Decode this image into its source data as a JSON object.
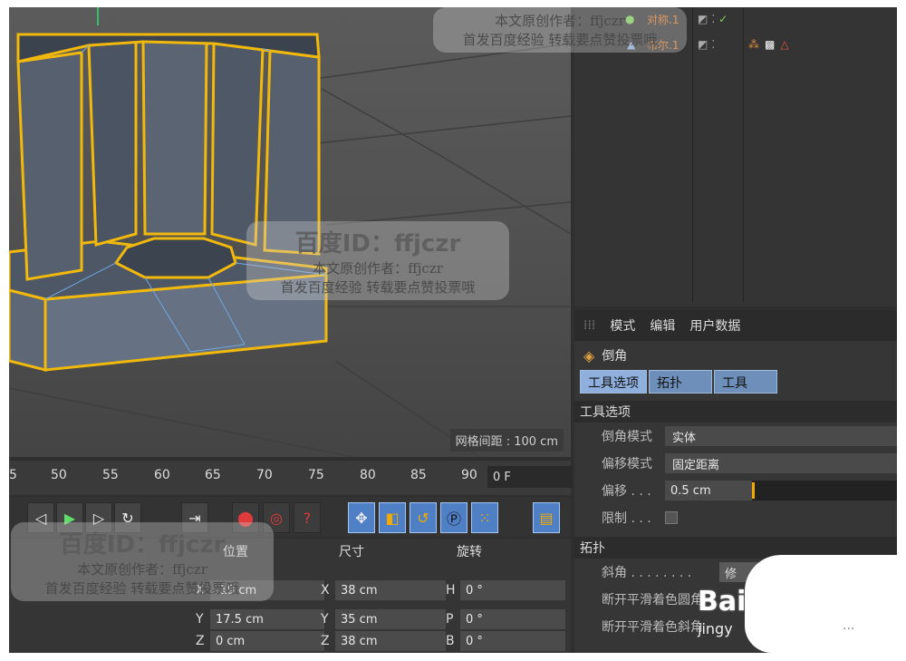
{
  "viewport": {
    "grid_label": "网格间距 : 100 cm"
  },
  "objects": [
    {
      "name": "对称.1",
      "flag": "✓"
    },
    {
      "name": "布尔.1",
      "flag": ""
    }
  ],
  "attributes": {
    "menu": [
      "模式",
      "编辑",
      "用户数据"
    ],
    "title": "倒角",
    "tabs": [
      "工具选项",
      "拓扑",
      "工具"
    ],
    "section_tool": "工具选项",
    "bevel_mode_label": "倒角模式",
    "bevel_mode_value": "实体",
    "offset_mode_label": "偏移模式",
    "offset_mode_value": "固定距离",
    "offset_label": "偏移 . . .",
    "offset_value": "0.5 cm",
    "limit_label": "限制 . . .",
    "section_topology": "拓扑",
    "miter_label": "斜角 . . . . . . . .",
    "miter_value": "修",
    "break_smooth_1": "断开平滑着色圆角",
    "break_smooth_2": "断开平滑着色斜角"
  },
  "timeline": {
    "ticks": [
      "5",
      "50",
      "55",
      "60",
      "65",
      "70",
      "75",
      "80",
      "85",
      "90"
    ],
    "frame": "0 F"
  },
  "coords": {
    "headers": [
      "位置",
      "尺寸",
      "旋转"
    ],
    "rows": [
      {
        "pos_axis": "X",
        "pos": "-19 cm",
        "size_axis": "X",
        "size": "38 cm",
        "rot_axis": "H",
        "rot": "0 °"
      },
      {
        "pos_axis": "Y",
        "pos": "17.5 cm",
        "size_axis": "Y",
        "size": "35 cm",
        "rot_axis": "P",
        "rot": "0 °"
      },
      {
        "pos_axis": "Z",
        "pos": "0 cm",
        "size_axis": "Z",
        "size": "38 cm",
        "rot_axis": "B",
        "rot": "0 °"
      }
    ]
  },
  "watermark": {
    "id": "百度ID：ffjczr",
    "line1": "本文原创作者：ffjczr",
    "line2": "首发百度经验 转载要点赞投票哦",
    "brand": "Bai",
    "brand_sub": "jingy",
    "dots": "..."
  },
  "colors": {
    "accent": "#f2a900",
    "tab": "#8fb0dd",
    "object_name": "#e07b2a"
  }
}
